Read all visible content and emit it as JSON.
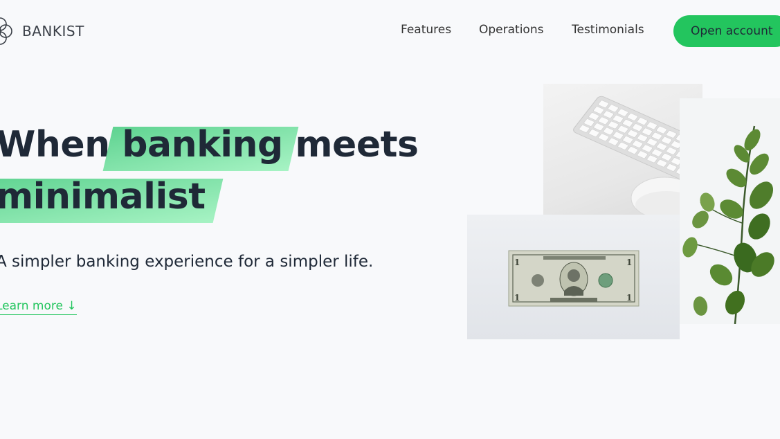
{
  "brand": {
    "name": "BANKIST"
  },
  "nav": {
    "links": [
      "Features",
      "Operations",
      "Testimonials"
    ],
    "cta": "Open account"
  },
  "hero": {
    "title_line1_pre": "When ",
    "title_line1_highlight": "banking",
    "title_line1_post": " meets",
    "title_line2_highlight": "minimalist",
    "subtitle": "A simpler banking experience for a simpler life.",
    "learn_more": "Learn more ↓"
  },
  "images": {
    "keyboard": "keyboard-and-mouse-photo",
    "dollar": "dollar-bill-photo",
    "plant": "eucalyptus-plant-photo"
  },
  "colors": {
    "accent": "#23c55e",
    "highlight_from": "#5fd391",
    "highlight_to": "#a7f3c4",
    "text": "#1f2937",
    "background": "#f8f9fb"
  }
}
